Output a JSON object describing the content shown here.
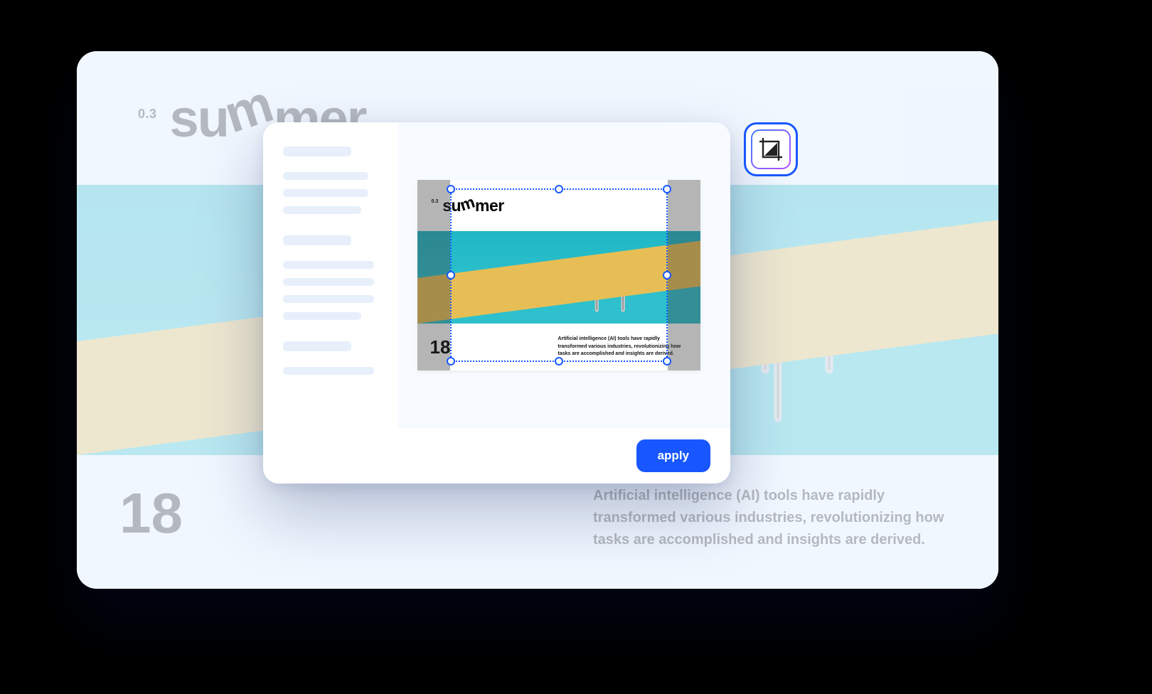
{
  "design": {
    "version_label": "0.3",
    "title_word": "summer",
    "page_number": "18",
    "blurb": "Artificial intelligence (AI) tools have rapidly transformed various industries, revolutionizing how tasks are accomplished and insights are derived."
  },
  "modal": {
    "apply_label": "apply"
  },
  "tool": {
    "name": "crop-tool"
  },
  "colors": {
    "accent": "#1857ff",
    "water": "#1fb7c6",
    "sand": "#e7be56"
  }
}
